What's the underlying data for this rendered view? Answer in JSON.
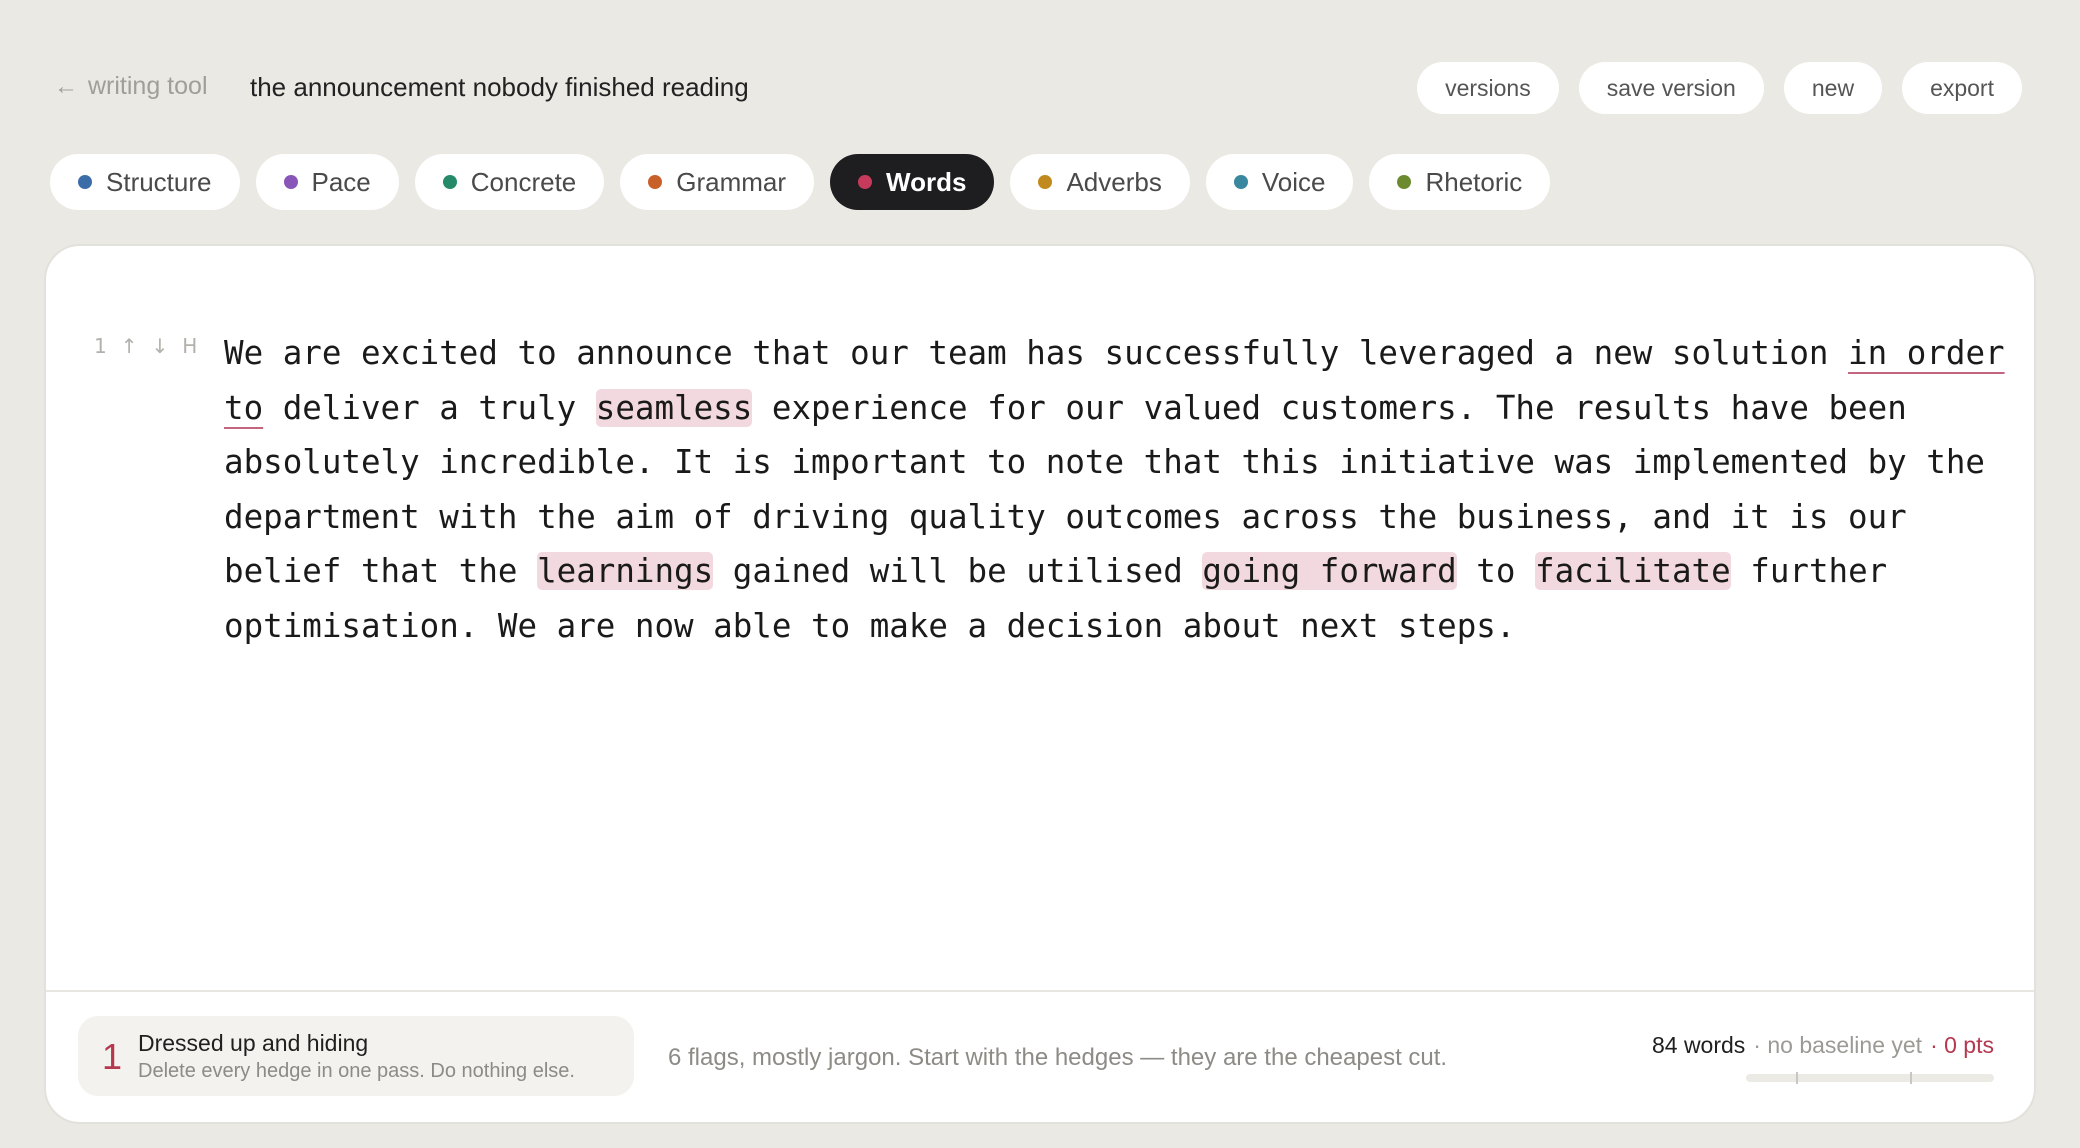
{
  "header": {
    "back_label": "writing tool",
    "doc_title": "the announcement nobody finished reading",
    "actions": {
      "versions": "versions",
      "save_version": "save version",
      "new": "new",
      "export": "export"
    }
  },
  "tabs": [
    {
      "label": "Structure",
      "color": "#3b6ea8",
      "active": false
    },
    {
      "label": "Pace",
      "color": "#8a55b8",
      "active": false
    },
    {
      "label": "Concrete",
      "color": "#248a6a",
      "active": false
    },
    {
      "label": "Grammar",
      "color": "#c8602a",
      "active": false
    },
    {
      "label": "Words",
      "color": "#c73a5c",
      "active": true
    },
    {
      "label": "Adverbs",
      "color": "#c08a1e",
      "active": false
    },
    {
      "label": "Voice",
      "color": "#3a87a0",
      "active": false
    },
    {
      "label": "Rhetoric",
      "color": "#6c8a2e",
      "active": false
    }
  ],
  "editor": {
    "paragraph_number": "1",
    "controls": {
      "up": "↑",
      "down": "↓",
      "heading": "H"
    },
    "segments": {
      "s1": "We are excited to announce that our team has successfully leveraged a new solution ",
      "u1": "in order to",
      "s2": " deliver a truly ",
      "h1": "seamless",
      "s3": " experience for our valued customers. The results have been absolutely incredible. It is important to note that this initiative was implemented by the department with the aim of driving quality outcomes across the business, and it is our belief that the ",
      "h2": "learnings",
      "s4": " gained will be utilised ",
      "h3": "going forward",
      "s5": " to ",
      "h4": "facilitate",
      "s6": " further optimisation. We are now able to make a decision about next steps."
    }
  },
  "footer": {
    "tip": {
      "number": "1",
      "title": "Dressed up and hiding",
      "subtitle": "Delete every hedge in one pass. Do nothing else."
    },
    "summary": "6 flags, mostly jargon. Start with the hedges — they are the cheapest cut.",
    "stats": {
      "words": "84 words",
      "baseline": "· no baseline yet",
      "points": "· 0 pts"
    },
    "progress_fraction": 0
  }
}
